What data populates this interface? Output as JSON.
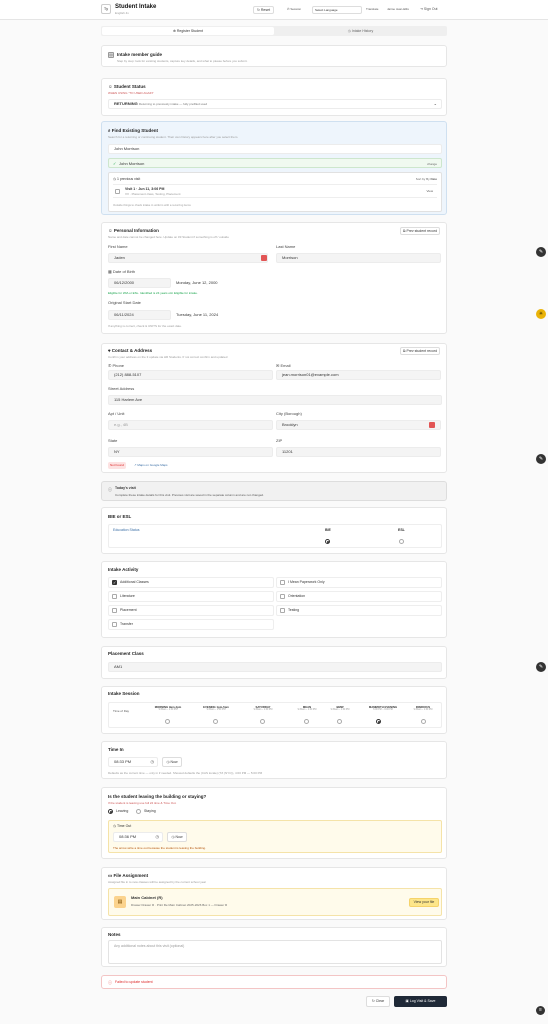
{
  "app": {
    "icon": "Ту",
    "title": "Student Intake",
    "subtitle": "English 4x"
  },
  "topbar": {
    "reset": "Reset",
    "session": "Session",
    "language": "Select Language",
    "translate": "Translate",
    "user": "Jaime Jean-Ellis",
    "signout": "Sign Out"
  },
  "tabs": [
    {
      "label": "Register Student"
    },
    {
      "label": "Intake History"
    }
  ],
  "guide": {
    "title": "Intake member guide",
    "text": "Step by step: look for existing students, capture key details, and what to please before you submit."
  },
  "status": {
    "title": "Student Status",
    "hint": "WHEN USING \"TO USED AGAIN\"",
    "value": "RETURNING",
    "value_desc": "Returning to previously intake — fully prefilled used"
  },
  "find": {
    "title": "Find Existing Student",
    "hint": "Search for a returning or continuing student. Their own history appears here after you select them.",
    "query": "John Morrison",
    "result": "John Morrison",
    "result_action": "change",
    "prev_visits": "1 previous visit",
    "sort_label": "Sort by By",
    "sort_value": "Date",
    "visit_title": "Visit 1 · Jun 11, 3:06 PM",
    "visit_meta": "XX · Placement class, Testing, Placement",
    "visit_action": "View",
    "footnote": "Outside things to check intake in uniform with a recurring items"
  },
  "personal": {
    "title": "Personal Information",
    "hint": "Name and date cannot be changed here. Update on #3 Student if something is off / outside",
    "fill_btn": "Prev student record",
    "first_name_label": "First Name",
    "first_name": "Jaden",
    "last_name_label": "Last Name",
    "last_name": "Morrison",
    "dob_label": "Date of Birth",
    "dob": "06/12/2000",
    "dob_text": "Monday, June 12, 2000",
    "age_text": "Eligible for WIA or ESL. Identified is 24 years old. Eligible for intake.",
    "start_label": "Original Start Date",
    "start": "06/11/2024",
    "start_text": "Tuesday, June 11, 2024",
    "start_hint": "If anything is correct, check & UNITS for the exact date."
  },
  "contact": {
    "title": "Contact & Address",
    "hint": "Confirm your address on the 3 update via HR Students. If not correct confirm and updated",
    "fill_btn": "Prev student record",
    "phone_label": "Phone",
    "phone": "(212) 888-5107",
    "email_label": "Email",
    "email": "jean.morrison01@example.com",
    "street_label": "Street Address",
    "street": "115 Harlem Ave",
    "apt_label": "Apt / Unit",
    "apt": "e.g., 4B",
    "city_label": "City (Borough)",
    "city": "Brooklyn",
    "state_label": "State",
    "state": "NY",
    "zip_label": "ZIP",
    "zip": "11201",
    "not_found": "Not Found",
    "maps": "Maps on Google Maps"
  },
  "note_box": {
    "title": "Today's visit",
    "text": "Complete these intake details for this visit. Previous visit are saved in the separate column and are not changed."
  },
  "bil": {
    "title": "BIE or ESL",
    "left": "Education Status",
    "col1": "BIE",
    "col2": "ESL"
  },
  "activity": {
    "title": "Intake Activity",
    "items": [
      "Additional Classes",
      "I Mean Paperwork Only",
      "Literature",
      "Orientation",
      "Placement",
      "Testing",
      "Transfer"
    ]
  },
  "placement": {
    "title": "Placement Class",
    "value": "AM1"
  },
  "session": {
    "title": "Intake Session",
    "row_label": "Time of Day",
    "cols": [
      {
        "name": "MORNING 9am-4pm",
        "sub": "9:30am – 1:30 PM"
      },
      {
        "name": "EVENING 1pm-5pm",
        "sub": "9:30am – 1:30 PM"
      },
      {
        "name": "SATURDAY",
        "sub": "9:30am – 1:30 PM"
      },
      {
        "name": "MEAN",
        "sub": "9:30am – 1:30 PM"
      },
      {
        "name": "BMW",
        "sub": "9:30am – 1:30 PM"
      },
      {
        "name": "MAMMOTH EVENING",
        "sub": "6:00 PM – 9:00 PM"
      },
      {
        "name": "INSIDIOUS",
        "sub": "9:30am – 1:30 PM"
      }
    ]
  },
  "timein": {
    "title": "Time In",
    "value": "08:33 PM",
    "now": "Now",
    "hint": "Defaults as the current time — only in if needed. Showed defaults the (CAS locale) (TZ (NYC)), 4:00 PM — 5:00 PM"
  },
  "leaving": {
    "title": "Is the student leaving the building or staying?",
    "hint": "If the student is leaving use full 24 time & Time Out.",
    "opt1": "Leaving",
    "opt2": "Staying",
    "timeout_label": "Time Out",
    "timeout": "08:36 PM",
    "now": "Now",
    "warn": "The arrow write a time out because the student is leaving the building."
  },
  "file": {
    "title": "File Assignment",
    "hint": "Assigned file in to new classes will be assigned by the current school year",
    "cabinet": "Main Cabinet (R)",
    "detail": "Drawer  Drawer R  ·  Print file  Main Cabinet 2025-2026 Box 1 — Drawer R",
    "btn": "View your file"
  },
  "notes": {
    "title": "Notes",
    "placeholder": "Any additional notes about this visit (optional)"
  },
  "error": "Failed to update student",
  "actions": {
    "clear": "Clear",
    "submit": "Log Visit & Save"
  },
  "colors": {
    "accent": "#1f2937",
    "info_bg": "#eef5fc",
    "warn_bg": "#fffbeb",
    "error": "#dc2626",
    "success": "#16a34a",
    "page_bg": "#fafafa"
  }
}
